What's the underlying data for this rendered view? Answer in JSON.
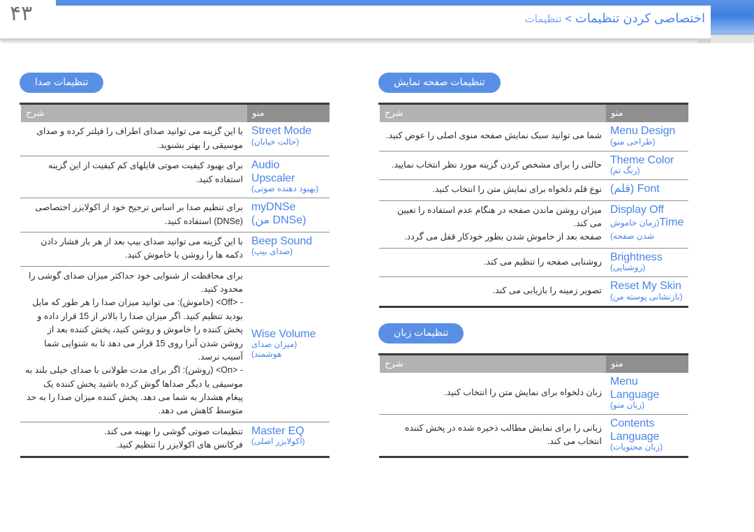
{
  "page": {
    "number": "۴۳"
  },
  "header": {
    "current": "اختصاصی کردن تنظیمات",
    "separator": ">",
    "parent": "تنظیمات"
  },
  "table_headers": {
    "menu": "منو",
    "description": "شرح"
  },
  "sections": [
    {
      "id": "sound-settings",
      "title": "تنظیمات صدا",
      "rows": [
        {
          "menu_en": "Street Mode",
          "menu_fa": "(حالت خیابان)",
          "description": "با این گزینه می توانید صدای اطراف را فیلتر کرده و صدای موسیقی را بهتر بشنوید."
        },
        {
          "menu_en": "Audio Upscaler",
          "menu_fa": "(بهبود دهنده صوتی)",
          "description": "برای بهبود کیفیت صوتی فایلهای کم کیفیت از این گزینه استفاده کنید."
        },
        {
          "menu_en": "myDNSe",
          "menu_fa": "(DNSe من)",
          "description": "برای تنظیم صدا بر اساس ترجیح خود از اکولایزر اختصاصی (DNSe) استفاده کنید."
        },
        {
          "menu_en": "Beep Sound",
          "menu_fa": "(صدای بیپ)",
          "description": "با این گزینه می توانید صدای بیپ بعد از هر بار فشار دادن دکمه ها را روشن یا خاموش کنید."
        },
        {
          "menu_en": "Wise Volume",
          "menu_fa": "(میزان صدای هوشمند)",
          "description_intro": "برای محافظت از شنوایی خود حداکثر میزان صدای گوشی را محدود کنید.",
          "bullets": [
            "-   <Off> (خاموش): می توانید میزان صدا را هر طور که مایل بودید تنظیم کنید. اگر میزان صدا را بالاتر از 15 قرار داده و پخش کننده را خاموش و روشن کنید، پخش کننده بعد از روشن شدن آنرا روی 15 قرار می دهد تا به شنوایی شما آسیب نرسد.",
            "-   <On> (روشن): اگر برای مدت طولانی با صدای خیلی بلند به موسیقی یا دیگر صداها گوش کرده باشید پخش کننده یک پیغام هشدار به شما می دهد. پخش کننده میزان صدا را به حد متوسط کاهش می دهد."
          ]
        },
        {
          "menu_en": "Master EQ",
          "menu_fa": "(اکولایزر اصلی)",
          "description_line1": "تنظیمات صوتی گوشی را بهینه می کند.",
          "description_line2": "فرکانس های اکولایزر را تنظیم کنید."
        }
      ]
    },
    {
      "id": "display-settings",
      "title": "تنظیمات صفحه نمایش",
      "rows": [
        {
          "menu_en": "Menu Design",
          "menu_fa": "(طراحی منو)",
          "description": "شما می توانید سبک نمایش صفحه منوی اصلی را عوض کنید."
        },
        {
          "menu_en": "Theme Color",
          "menu_fa": "(رنگ تم)",
          "description": "حالتی را برای مشخص کردن گزینه مورد نظر انتخاب نمایید."
        },
        {
          "menu_en": "Font (قلم)",
          "menu_fa": "",
          "description": "نوع قلم دلخواه برای نمایش متن را انتخاب کنید."
        },
        {
          "menu_en": "Display Off",
          "menu_en2": "Time",
          "menu_fa": "(زمان خاموش شدن صفحه)",
          "description_line1": "میزان روشن ماندن صفحه در هنگام عدم استفاده را تعیین می کند.",
          "description_line2": "صفحه بعد از خاموش شدن بطور خودکار قفل می گردد."
        },
        {
          "menu_en": "Brightness",
          "menu_fa": "(روشنایی)",
          "description": "روشنایی صفحه را تنظیم می کند."
        },
        {
          "menu_en": "Reset My Skin",
          "menu_fa": "(بازنشانی پوسته من)",
          "description": "تصویر زمینه را بازیابی می کند."
        }
      ]
    },
    {
      "id": "language-settings",
      "title": "تنظیمات زبان",
      "rows": [
        {
          "menu_en": "Menu",
          "menu_en2": "Language",
          "menu_fa": "(زبان منو)",
          "description": "زبان دلخواه برای نمایش متن را انتخاب کنید."
        },
        {
          "menu_en": "Contents",
          "menu_en2": "Language",
          "menu_fa": "(زبان محتویات)",
          "description": "زبانی را برای نمایش مطالب ذخیره شده در پخش کننده انتخاب می کند."
        }
      ]
    }
  ],
  "colors": {
    "accent_blue": "#4a84e8",
    "pill_blue": "#5a8fe6",
    "header_gradient_top": "#5b93e8",
    "table_header_menu": "#8f8f8f",
    "table_header_desc": "#b2b2b2",
    "rule_dark": "#3a3a3a"
  }
}
